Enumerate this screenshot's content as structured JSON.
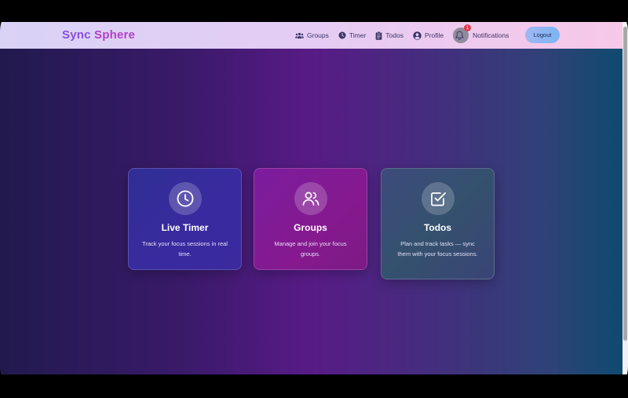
{
  "brand": {
    "part1": "Sync ",
    "part2": "Sphere"
  },
  "nav": {
    "groups": "Groups",
    "timer": "Timer",
    "todos": "Todos",
    "profile": "Profile",
    "notifications": "Notifications",
    "notification_count": "1",
    "logout": "Logout"
  },
  "cards": [
    {
      "title": "Live Timer",
      "description": "Track your focus sessions in real time.",
      "icon": "clock-icon"
    },
    {
      "title": "Groups",
      "description": "Manage and join your focus groups.",
      "icon": "users-icon"
    },
    {
      "title": "Todos",
      "description": "Plan and track tasks — sync them with your focus sessions.",
      "icon": "checkbox-icon"
    }
  ],
  "colors": {
    "brand_primary": "#8a4ee0",
    "brand_secondary": "#b33fc9",
    "badge": "#e23b4c"
  }
}
